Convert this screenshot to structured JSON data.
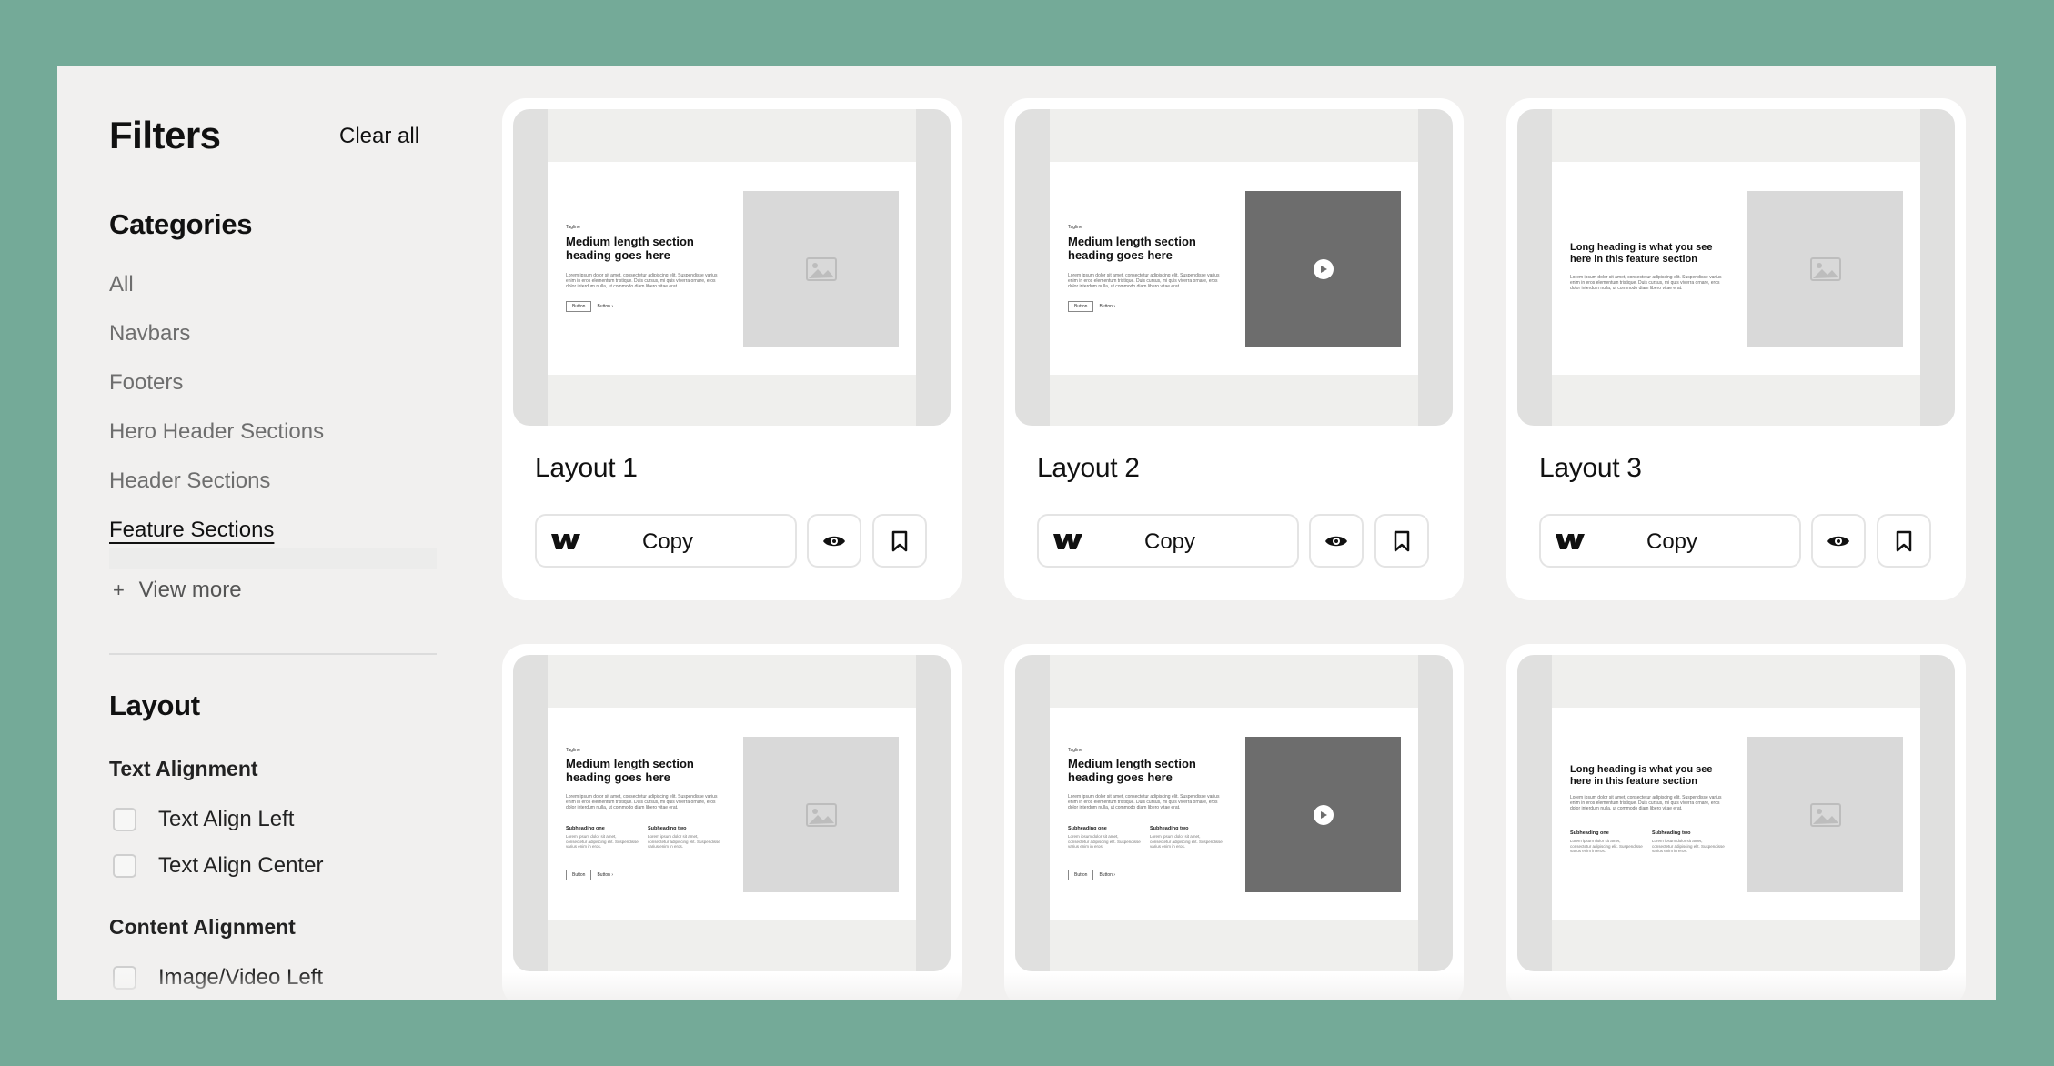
{
  "sidebar": {
    "title": "Filters",
    "clear_all": "Clear all",
    "categories_title": "Categories",
    "categories": [
      {
        "label": "All"
      },
      {
        "label": "Navbars"
      },
      {
        "label": "Footers"
      },
      {
        "label": "Hero Header Sections"
      },
      {
        "label": "Header Sections"
      },
      {
        "label": "Feature Sections",
        "active": true
      }
    ],
    "view_more": "View more",
    "layout_title": "Layout",
    "text_alignment": {
      "title": "Text Alignment",
      "options": [
        {
          "label": "Text Align Left",
          "checked": false
        },
        {
          "label": "Text Align Center",
          "checked": false
        }
      ]
    },
    "content_alignment": {
      "title": "Content Alignment",
      "options": [
        {
          "label": "Image/Video Left",
          "checked": false
        }
      ]
    }
  },
  "cards": [
    {
      "title": "Layout 1",
      "copy_label": "Copy",
      "preview": {
        "tagline": "Tagline",
        "heading": "Medium length section heading goes here",
        "body": "Lorem ipsum dolor sit amet, consectetur adipiscing elit. Suspendisse varius enim in eros elementum tristique. Duis cursus, mi quis viverra ornare, eros dolor interdum nulla, ut commodo diam libero vitae erat.",
        "button": "Button",
        "link": "Button ›",
        "media": "image-icon"
      }
    },
    {
      "title": "Layout 2",
      "copy_label": "Copy",
      "preview": {
        "tagline": "Tagline",
        "heading": "Medium length section heading goes here",
        "body": "Lorem ipsum dolor sit amet, consectetur adipiscing elit. Suspendisse varius enim in eros elementum tristique. Duis cursus, mi quis viverra ornare, eros dolor interdum nulla, ut commodo diam libero vitae erat.",
        "button": "Button",
        "link": "Button ›",
        "media": "play-icon"
      }
    },
    {
      "title": "Layout 3",
      "copy_label": "Copy",
      "preview": {
        "heading": "Long heading is what you see here in this feature section",
        "body": "Lorem ipsum dolor sit amet, consectetur adipiscing elit. Suspendisse varius enim in eros elementum tristique. Duis cursus, mi quis viverra ornare, eros dolor interdum nulla, ut commodo diam libero vitae erat.",
        "media": "image-icon"
      }
    },
    {
      "preview": {
        "tagline": "Tagline",
        "heading": "Medium length section heading goes here",
        "body": "Lorem ipsum dolor sit amet, consectetur adipiscing elit. Suspendisse varius enim in eros elementum tristique. Duis cursus, mi quis viverra ornare, eros dolor interdum nulla, ut commodo diam libero vitae erat.",
        "sub1_head": "Subheading one",
        "sub1_text": "Lorem ipsum dolor sit amet, consectetur adipiscing elit. Suspendisse varius enim in eros.",
        "sub2_head": "Subheading two",
        "sub2_text": "Lorem ipsum dolor sit amet, consectetur adipiscing elit. Suspendisse varius enim in eros.",
        "button": "Button",
        "link": "Button ›",
        "media": "image-icon"
      }
    },
    {
      "preview": {
        "tagline": "Tagline",
        "heading": "Medium length section heading goes here",
        "body": "Lorem ipsum dolor sit amet, consectetur adipiscing elit. Suspendisse varius enim in eros elementum tristique. Duis cursus, mi quis viverra ornare, eros dolor interdum nulla, ut commodo diam libero vitae erat.",
        "sub1_head": "Subheading one",
        "sub1_text": "Lorem ipsum dolor sit amet, consectetur adipiscing elit. Suspendisse varius enim in eros.",
        "sub2_head": "Subheading two",
        "sub2_text": "Lorem ipsum dolor sit amet, consectetur adipiscing elit. Suspendisse varius enim in eros.",
        "button": "Button",
        "link": "Button ›",
        "media": "play-icon"
      }
    },
    {
      "preview": {
        "heading": "Long heading is what you see here in this feature section",
        "body": "Lorem ipsum dolor sit amet, consectetur adipiscing elit. Suspendisse varius enim in eros elementum tristique. Duis cursus, mi quis viverra ornare, eros dolor interdum nulla, ut commodo diam libero vitae erat.",
        "sub1_head": "Subheading one",
        "sub1_text": "Lorem ipsum dolor sit amet, consectetur adipiscing elit. Suspendisse varius enim in eros.",
        "sub2_head": "Subheading two",
        "sub2_text": "Lorem ipsum dolor sit amet, consectetur adipiscing elit. Suspendisse varius enim in eros.",
        "media": "image-icon"
      }
    }
  ],
  "icons": {
    "webflow": "webflow-icon",
    "preview": "eye-icon",
    "save": "bookmark-icon",
    "plus": "plus-icon"
  },
  "colors": {
    "frame_background": "#74aa98",
    "panel_background": "#f1f0ef",
    "card_background": "#ffffff",
    "video_placeholder": "#6d6d6d",
    "image_placeholder": "#d9d9d9"
  }
}
